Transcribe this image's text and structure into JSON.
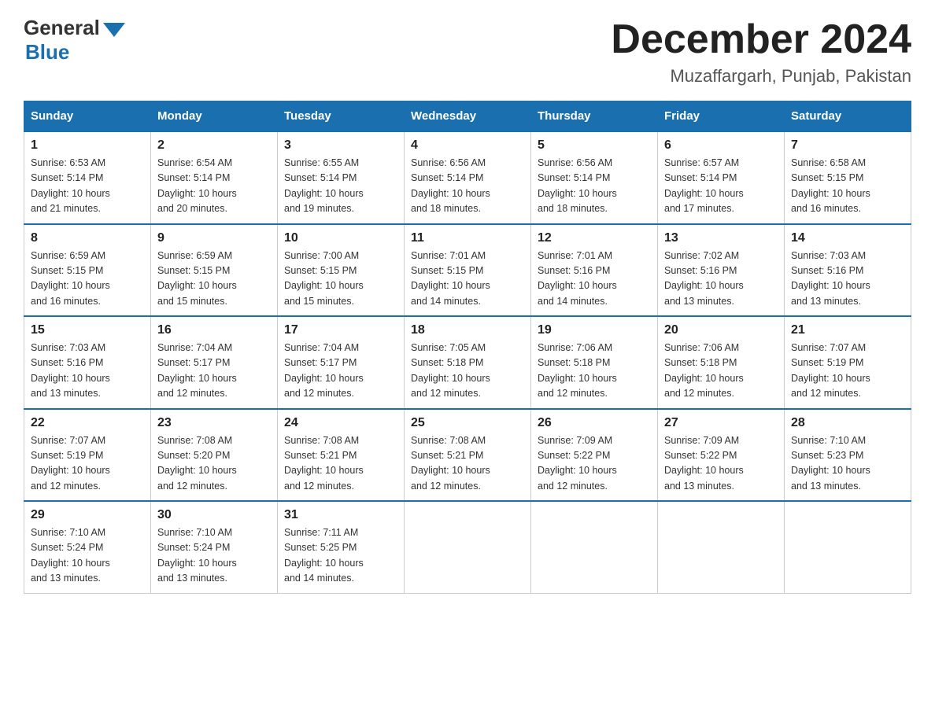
{
  "logo": {
    "general": "General",
    "blue": "Blue"
  },
  "title": "December 2024",
  "subtitle": "Muzaffargarh, Punjab, Pakistan",
  "days": [
    "Sunday",
    "Monday",
    "Tuesday",
    "Wednesday",
    "Thursday",
    "Friday",
    "Saturday"
  ],
  "weeks": [
    [
      {
        "num": "1",
        "sunrise": "6:53 AM",
        "sunset": "5:14 PM",
        "daylight": "10 hours and 21 minutes."
      },
      {
        "num": "2",
        "sunrise": "6:54 AM",
        "sunset": "5:14 PM",
        "daylight": "10 hours and 20 minutes."
      },
      {
        "num": "3",
        "sunrise": "6:55 AM",
        "sunset": "5:14 PM",
        "daylight": "10 hours and 19 minutes."
      },
      {
        "num": "4",
        "sunrise": "6:56 AM",
        "sunset": "5:14 PM",
        "daylight": "10 hours and 18 minutes."
      },
      {
        "num": "5",
        "sunrise": "6:56 AM",
        "sunset": "5:14 PM",
        "daylight": "10 hours and 18 minutes."
      },
      {
        "num": "6",
        "sunrise": "6:57 AM",
        "sunset": "5:14 PM",
        "daylight": "10 hours and 17 minutes."
      },
      {
        "num": "7",
        "sunrise": "6:58 AM",
        "sunset": "5:15 PM",
        "daylight": "10 hours and 16 minutes."
      }
    ],
    [
      {
        "num": "8",
        "sunrise": "6:59 AM",
        "sunset": "5:15 PM",
        "daylight": "10 hours and 16 minutes."
      },
      {
        "num": "9",
        "sunrise": "6:59 AM",
        "sunset": "5:15 PM",
        "daylight": "10 hours and 15 minutes."
      },
      {
        "num": "10",
        "sunrise": "7:00 AM",
        "sunset": "5:15 PM",
        "daylight": "10 hours and 15 minutes."
      },
      {
        "num": "11",
        "sunrise": "7:01 AM",
        "sunset": "5:15 PM",
        "daylight": "10 hours and 14 minutes."
      },
      {
        "num": "12",
        "sunrise": "7:01 AM",
        "sunset": "5:16 PM",
        "daylight": "10 hours and 14 minutes."
      },
      {
        "num": "13",
        "sunrise": "7:02 AM",
        "sunset": "5:16 PM",
        "daylight": "10 hours and 13 minutes."
      },
      {
        "num": "14",
        "sunrise": "7:03 AM",
        "sunset": "5:16 PM",
        "daylight": "10 hours and 13 minutes."
      }
    ],
    [
      {
        "num": "15",
        "sunrise": "7:03 AM",
        "sunset": "5:16 PM",
        "daylight": "10 hours and 13 minutes."
      },
      {
        "num": "16",
        "sunrise": "7:04 AM",
        "sunset": "5:17 PM",
        "daylight": "10 hours and 12 minutes."
      },
      {
        "num": "17",
        "sunrise": "7:04 AM",
        "sunset": "5:17 PM",
        "daylight": "10 hours and 12 minutes."
      },
      {
        "num": "18",
        "sunrise": "7:05 AM",
        "sunset": "5:18 PM",
        "daylight": "10 hours and 12 minutes."
      },
      {
        "num": "19",
        "sunrise": "7:06 AM",
        "sunset": "5:18 PM",
        "daylight": "10 hours and 12 minutes."
      },
      {
        "num": "20",
        "sunrise": "7:06 AM",
        "sunset": "5:18 PM",
        "daylight": "10 hours and 12 minutes."
      },
      {
        "num": "21",
        "sunrise": "7:07 AM",
        "sunset": "5:19 PM",
        "daylight": "10 hours and 12 minutes."
      }
    ],
    [
      {
        "num": "22",
        "sunrise": "7:07 AM",
        "sunset": "5:19 PM",
        "daylight": "10 hours and 12 minutes."
      },
      {
        "num": "23",
        "sunrise": "7:08 AM",
        "sunset": "5:20 PM",
        "daylight": "10 hours and 12 minutes."
      },
      {
        "num": "24",
        "sunrise": "7:08 AM",
        "sunset": "5:21 PM",
        "daylight": "10 hours and 12 minutes."
      },
      {
        "num": "25",
        "sunrise": "7:08 AM",
        "sunset": "5:21 PM",
        "daylight": "10 hours and 12 minutes."
      },
      {
        "num": "26",
        "sunrise": "7:09 AM",
        "sunset": "5:22 PM",
        "daylight": "10 hours and 12 minutes."
      },
      {
        "num": "27",
        "sunrise": "7:09 AM",
        "sunset": "5:22 PM",
        "daylight": "10 hours and 13 minutes."
      },
      {
        "num": "28",
        "sunrise": "7:10 AM",
        "sunset": "5:23 PM",
        "daylight": "10 hours and 13 minutes."
      }
    ],
    [
      {
        "num": "29",
        "sunrise": "7:10 AM",
        "sunset": "5:24 PM",
        "daylight": "10 hours and 13 minutes."
      },
      {
        "num": "30",
        "sunrise": "7:10 AM",
        "sunset": "5:24 PM",
        "daylight": "10 hours and 13 minutes."
      },
      {
        "num": "31",
        "sunrise": "7:11 AM",
        "sunset": "5:25 PM",
        "daylight": "10 hours and 14 minutes."
      },
      null,
      null,
      null,
      null
    ]
  ],
  "labels": {
    "sunrise": "Sunrise:",
    "sunset": "Sunset:",
    "daylight": "Daylight:"
  }
}
